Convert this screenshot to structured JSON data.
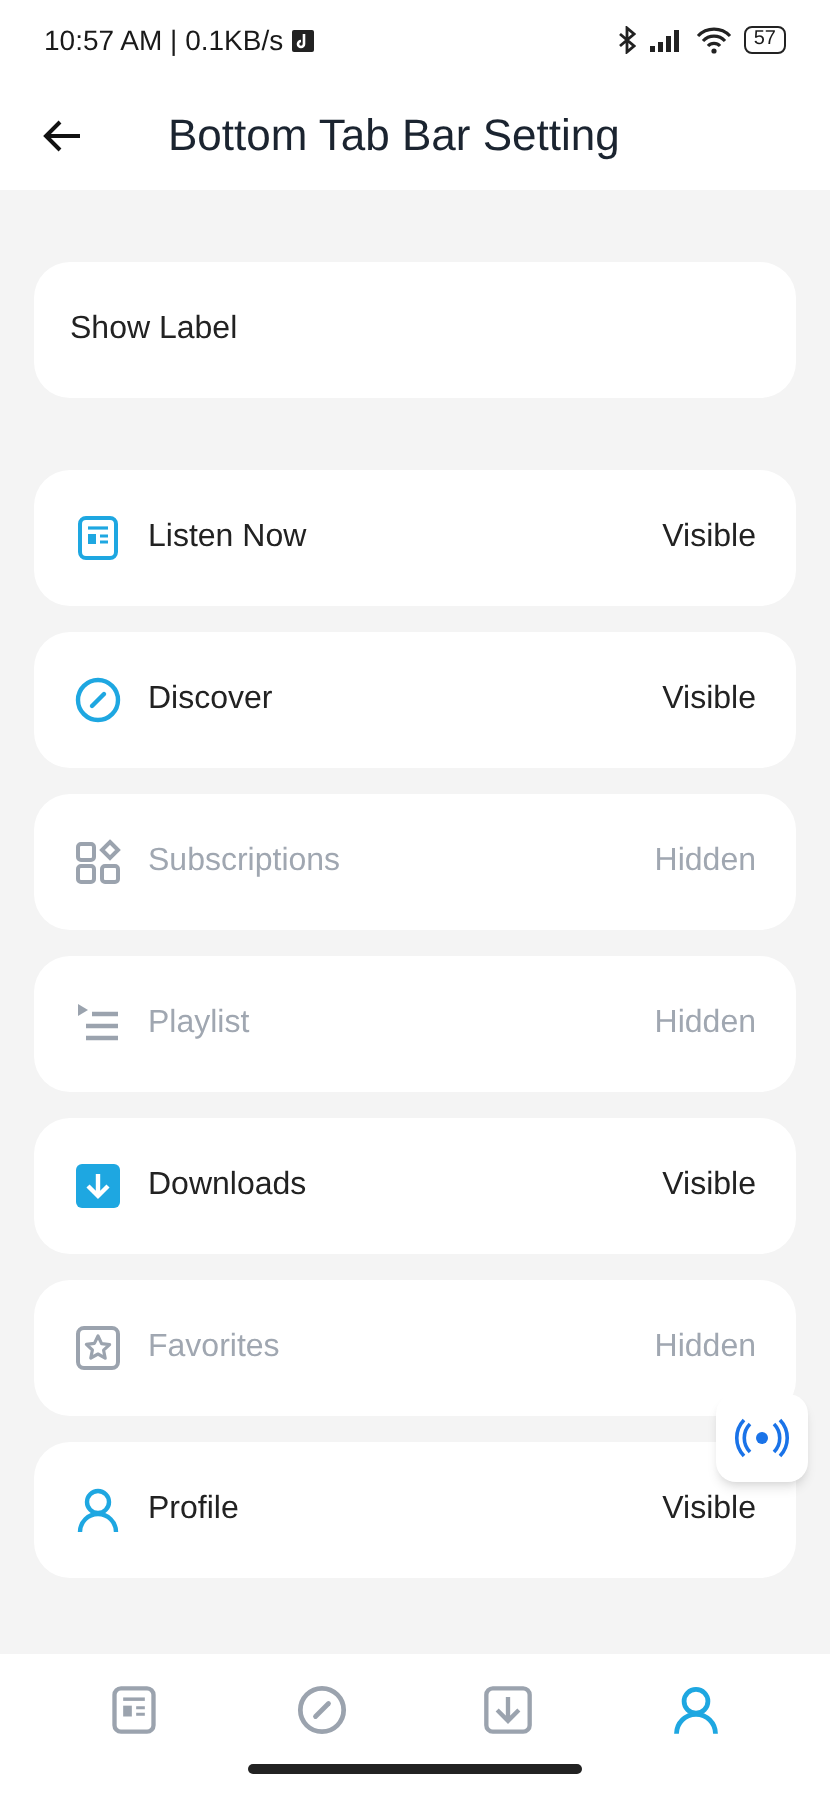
{
  "status_bar": {
    "time": "10:57 AM | 0.1KB/s",
    "battery": "57"
  },
  "header": {
    "title": "Bottom Tab Bar Setting"
  },
  "show_label": {
    "label": "Show Label"
  },
  "tabs": [
    {
      "kind": "listen",
      "label": "Listen Now",
      "status": "Visible",
      "visible": true
    },
    {
      "kind": "discover",
      "label": "Discover",
      "status": "Visible",
      "visible": true
    },
    {
      "kind": "subscriptions",
      "label": "Subscriptions",
      "status": "Hidden",
      "visible": false
    },
    {
      "kind": "playlist",
      "label": "Playlist",
      "status": "Hidden",
      "visible": false
    },
    {
      "kind": "downloads",
      "label": "Downloads",
      "status": "Visible",
      "visible": true
    },
    {
      "kind": "favorites",
      "label": "Favorites",
      "status": "Hidden",
      "visible": false
    },
    {
      "kind": "profile",
      "label": "Profile",
      "status": "Visible",
      "visible": true
    }
  ],
  "bottom_nav": [
    {
      "kind": "listen",
      "selected": false
    },
    {
      "kind": "discover",
      "selected": false
    },
    {
      "kind": "downloads",
      "selected": false
    },
    {
      "kind": "profile",
      "selected": true
    }
  ]
}
